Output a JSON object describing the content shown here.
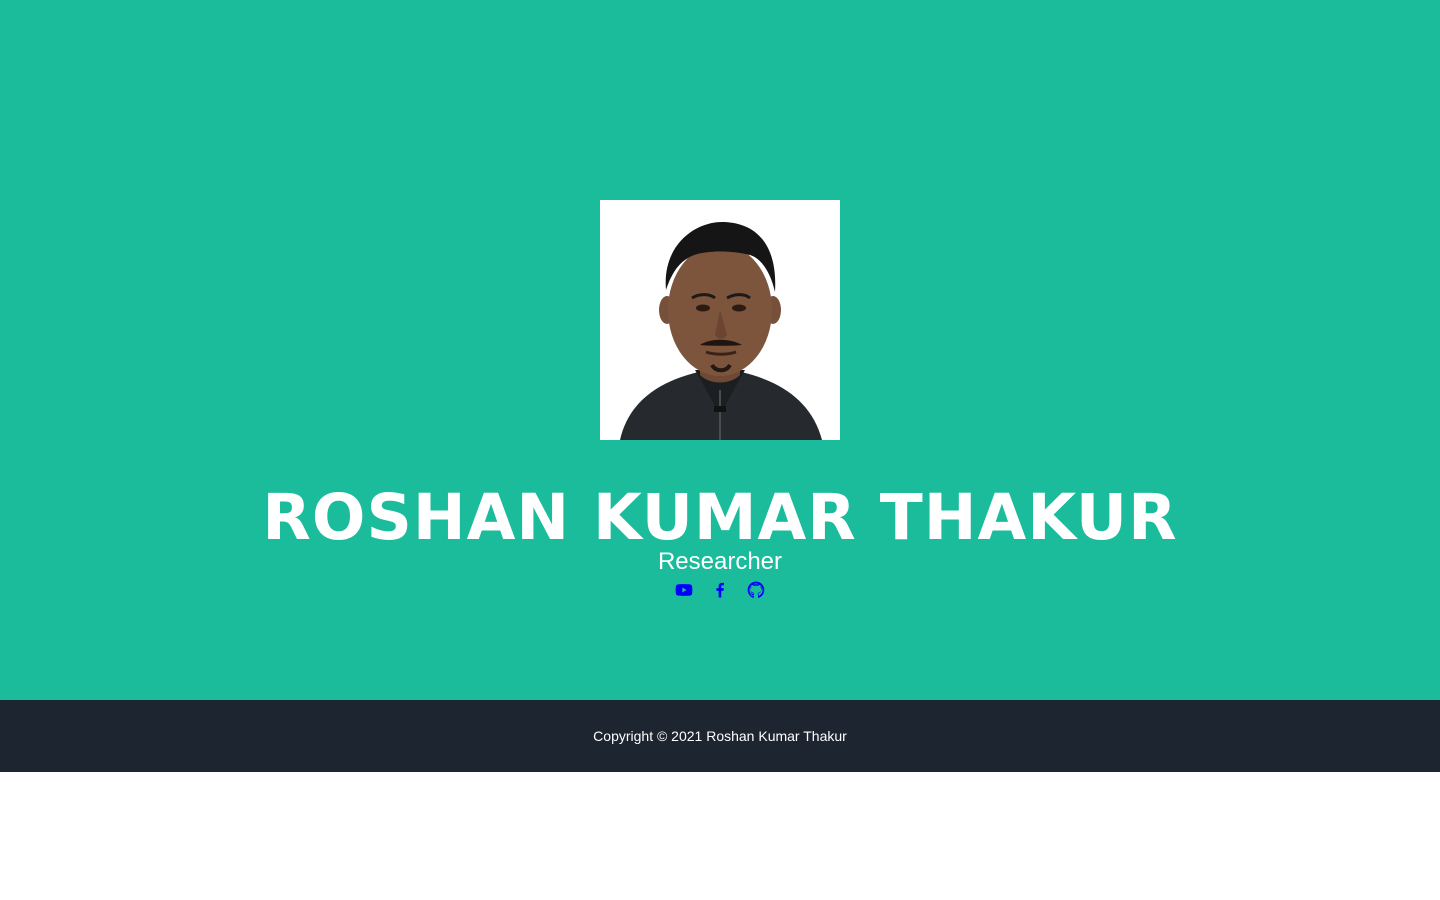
{
  "hero": {
    "background_color": "#1abc9c",
    "name": "ROSHAN KUMAR THAKUR",
    "role": "Researcher",
    "avatar_alt": "profile-photo"
  },
  "social_links": [
    {
      "icon": "youtube-icon",
      "color": "#0000ff"
    },
    {
      "icon": "facebook-icon",
      "color": "#0000ff"
    },
    {
      "icon": "github-icon",
      "color": "#0000ff"
    }
  ],
  "footer": {
    "background_color": "#1d2530",
    "copyright": "Copyright © 2021 Roshan Kumar Thakur"
  }
}
